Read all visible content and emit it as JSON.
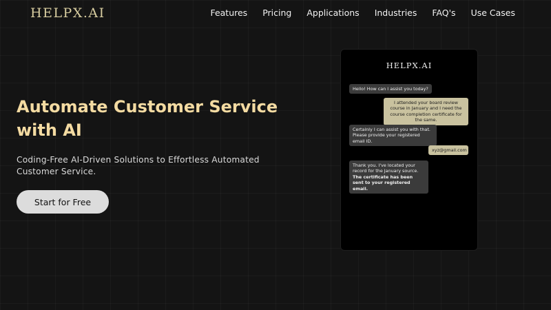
{
  "header": {
    "logo": "HELPX.AI",
    "nav": [
      "Features",
      "Pricing",
      "Applications",
      "Industries",
      "FAQ's",
      "Use Cases"
    ]
  },
  "hero": {
    "title_line1": "Automate Customer Service",
    "title_line2": "with AI",
    "subtitle": "Coding-Free AI-Driven Solutions to Effortless Automated Customer Service.",
    "cta_label": "Start for Free"
  },
  "chat": {
    "title": "HELPX.AI",
    "messages": [
      {
        "role": "bot",
        "text": "Hello! How can I assist you today?"
      },
      {
        "role": "user",
        "text": "I attended your board review course in January and I need the course completion certificate for the same."
      },
      {
        "role": "bot",
        "text": "Certainly I can assist you with that. Please provide your registered email ID."
      },
      {
        "role": "user",
        "text": "xyz@gmail.com"
      },
      {
        "role": "bot",
        "text": "Thank you. I've located your record for the January source.",
        "bold_text": "The certificate has been sent to your registered email."
      }
    ]
  },
  "colors": {
    "background": "#141414",
    "logo": "#d8cda0",
    "headline": "#f4dba2",
    "user_bubble": "#c9c29f",
    "bot_bubble": "#3b3b3b"
  }
}
